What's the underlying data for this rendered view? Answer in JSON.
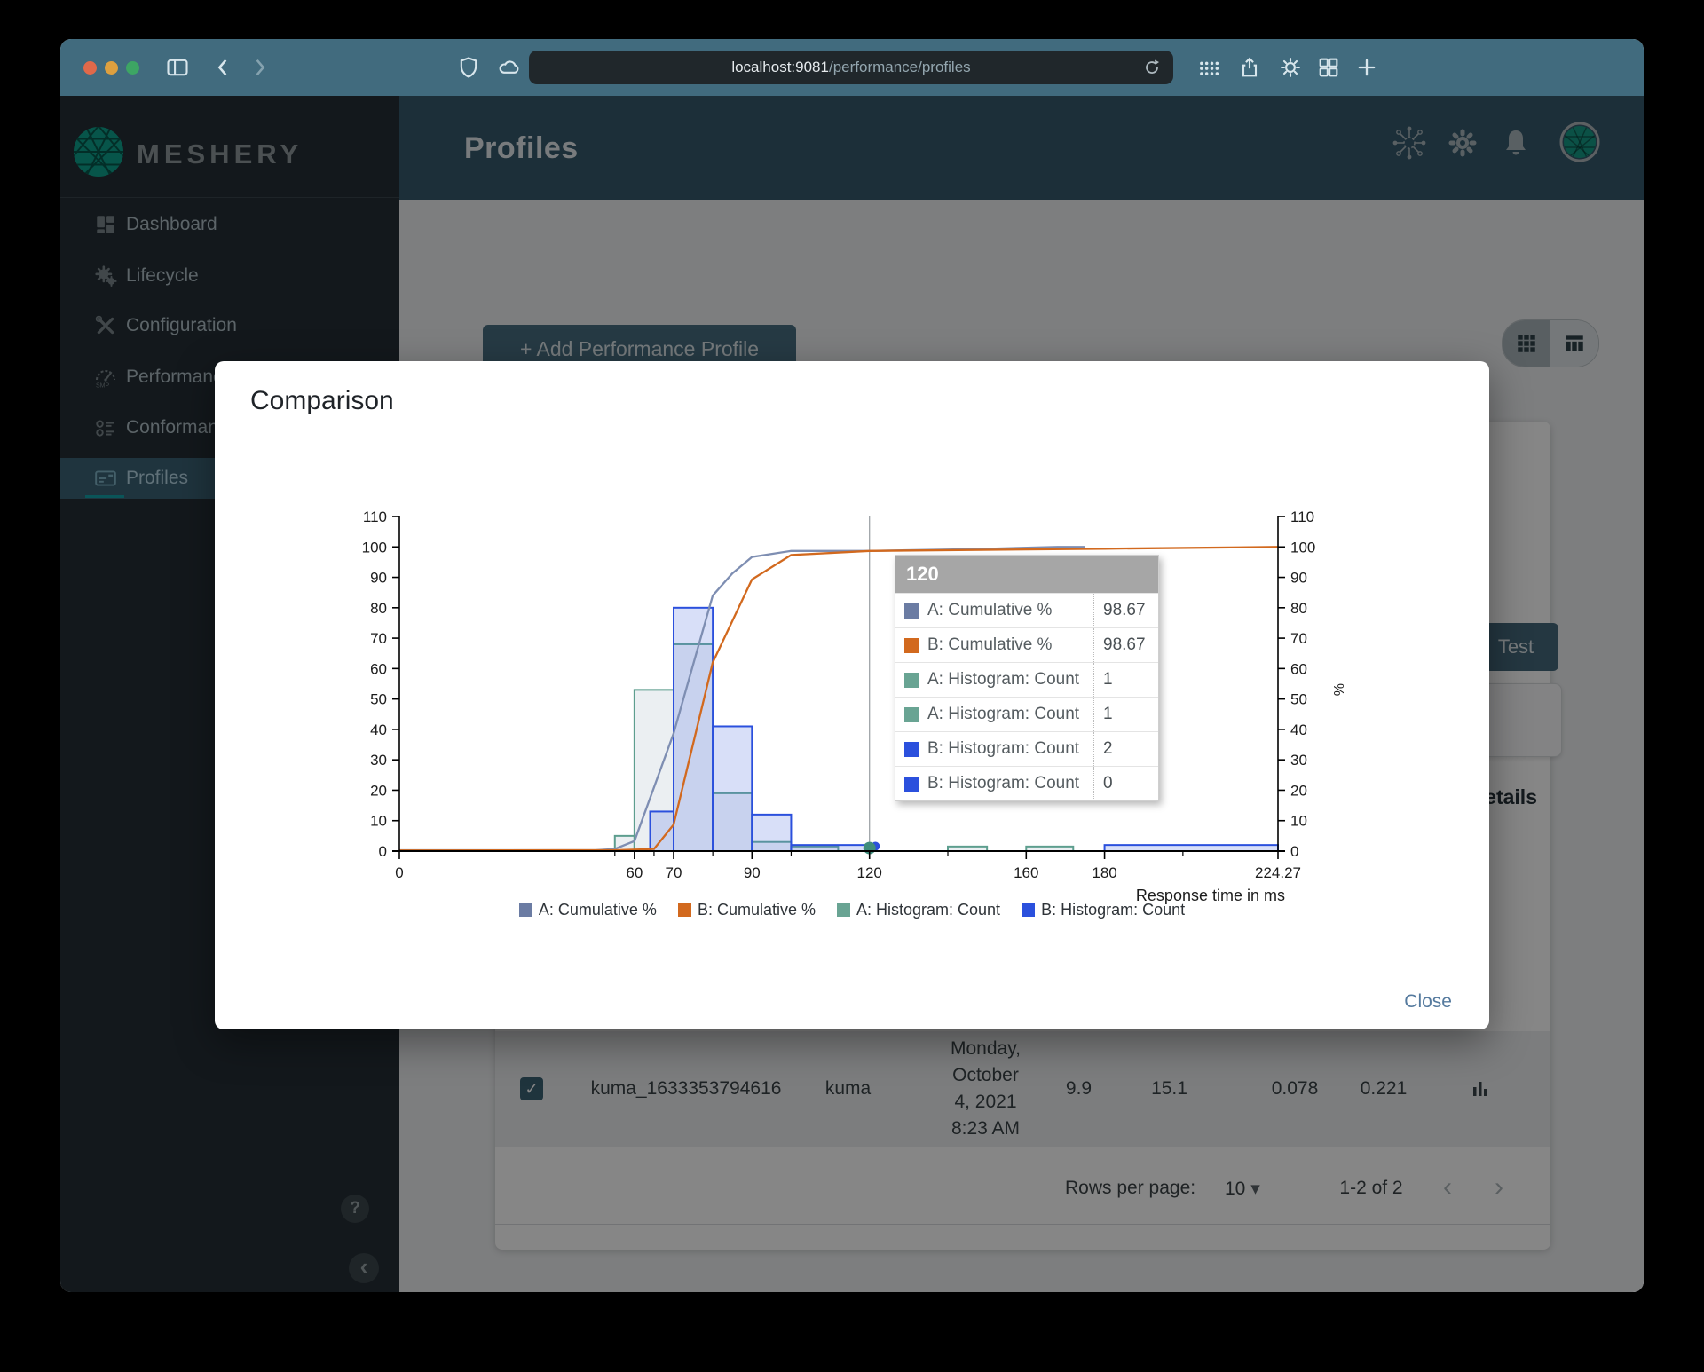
{
  "browser": {
    "url_host": "localhost:9081",
    "url_path": "/performance/profiles",
    "traffic_lights": [
      "#e0694a",
      "#dda03f",
      "#3da564"
    ]
  },
  "app": {
    "brand": "MESHERY",
    "page_title": "Profiles"
  },
  "sidebar": {
    "items": [
      {
        "label": "Dashboard"
      },
      {
        "label": "Lifecycle"
      },
      {
        "label": "Configuration"
      },
      {
        "label": "Performance",
        "sub": "SMP"
      },
      {
        "label": "Profiles"
      },
      {
        "label": "Conformance"
      }
    ],
    "help_glyph": "?",
    "collapse_glyph": "‹"
  },
  "content": {
    "add_button": "+ Add Performance Profile",
    "test_button": "Test",
    "details_heading": "Details",
    "back_arrow": "←"
  },
  "table": {
    "row": {
      "check_glyph": "✓",
      "name": "kuma_1633353794616",
      "mesh": "kuma",
      "date_lines": [
        "Monday,",
        "October",
        "4, 2021",
        "8:23 AM"
      ],
      "values": [
        "9.9",
        "15.1",
        "0.078",
        "0.221"
      ]
    }
  },
  "pagination": {
    "rows_per_page_label": "Rows per page:",
    "rows_per_page": "10",
    "caret": "▾",
    "range": "1-2 of 2",
    "prev": "‹",
    "next": "›"
  },
  "modal": {
    "title": "Comparison",
    "close_label": "Close"
  },
  "tooltip": {
    "title": "120",
    "rows": [
      {
        "swatch": "#6b7ca3",
        "label": "A: Cumulative %",
        "value": "98.67"
      },
      {
        "swatch": "#d2691e",
        "label": "B: Cumulative %",
        "value": "98.67"
      },
      {
        "swatch": "#69a493",
        "label": "A: Histogram: Count",
        "value": "1"
      },
      {
        "swatch": "#69a493",
        "label": "A: Histogram: Count",
        "value": "1"
      },
      {
        "swatch": "#2b50dd",
        "label": "B: Histogram: Count",
        "value": "2"
      },
      {
        "swatch": "#2b50dd",
        "label": "B: Histogram: Count",
        "value": "0"
      }
    ]
  },
  "legend": [
    {
      "label": "A: Cumulative %",
      "color": "#6b7ca3"
    },
    {
      "label": "B: Cumulative %",
      "color": "#d2691e"
    },
    {
      "label": "A: Histogram: Count",
      "color": "#69a493"
    },
    {
      "label": "B: Histogram: Count",
      "color": "#2b50dd"
    }
  ],
  "chart_data": {
    "type": "histogram+cumulative-line",
    "xlabel": "Response time in ms",
    "ylabel_right": "%",
    "xlim": [
      0,
      224.27
    ],
    "ylim": [
      0,
      110
    ],
    "y_ticks": [
      0,
      10,
      20,
      30,
      40,
      50,
      60,
      70,
      80,
      90,
      100,
      110
    ],
    "x_major_ticks": [
      0,
      60,
      70,
      90,
      120,
      160,
      180,
      224.27
    ],
    "x_minor_ticks": [
      55,
      65,
      80,
      100,
      140,
      200
    ],
    "hover_x": 120,
    "series": [
      {
        "name": "A: Histogram: Count",
        "type": "bars",
        "color": "#5d9e8e",
        "fill": "rgba(120,150,170,0.15)",
        "bins": [
          [
            55,
            60,
            5
          ],
          [
            60,
            70,
            53
          ],
          [
            70,
            80,
            68
          ],
          [
            80,
            90,
            19
          ],
          [
            90,
            100,
            3
          ],
          [
            100,
            112,
            1.5
          ],
          [
            140,
            150,
            1.5
          ],
          [
            160,
            172,
            1.5
          ]
        ]
      },
      {
        "name": "B: Histogram: Count",
        "type": "bars",
        "color": "#2b50dd",
        "fill": "rgba(76,108,222,0.22)",
        "bins": [
          [
            64,
            70,
            13
          ],
          [
            70,
            80,
            80
          ],
          [
            80,
            90,
            41
          ],
          [
            90,
            100,
            12
          ],
          [
            100,
            120,
            2
          ],
          [
            180,
            224.27,
            2
          ]
        ]
      },
      {
        "name": "A: Cumulative %",
        "type": "line",
        "color": "#7e8eb2",
        "points": [
          [
            0,
            0.3
          ],
          [
            50,
            0.3
          ],
          [
            55,
            0.7
          ],
          [
            60,
            3.3
          ],
          [
            70,
            38.7
          ],
          [
            80,
            84
          ],
          [
            85,
            91.3
          ],
          [
            90,
            96.7
          ],
          [
            100,
            98.67
          ],
          [
            120,
            98.67
          ],
          [
            148,
            99.33
          ],
          [
            168,
            100
          ],
          [
            175,
            100
          ]
        ]
      },
      {
        "name": "B: Cumulative %",
        "type": "line",
        "color": "#d2691e",
        "points": [
          [
            0,
            0.2
          ],
          [
            55,
            0.3
          ],
          [
            65,
            0.7
          ],
          [
            70,
            8.7
          ],
          [
            80,
            62
          ],
          [
            90,
            89.3
          ],
          [
            100,
            97.33
          ],
          [
            120,
            98.67
          ],
          [
            180,
            99.4
          ],
          [
            224.27,
            100
          ]
        ]
      }
    ],
    "markers": [
      {
        "x": 121.5,
        "y": 1.6,
        "r": 5,
        "color": "#2b50dd"
      },
      {
        "x": 120,
        "y": 1,
        "r": 7,
        "color": "#3f8d7c"
      }
    ]
  }
}
